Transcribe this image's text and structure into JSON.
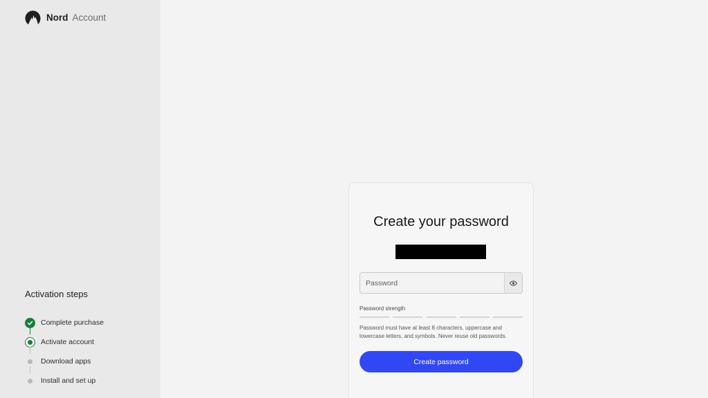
{
  "brand": {
    "name": "Nord",
    "product": "Account",
    "icon": "nord-mountain-logo-icon"
  },
  "activation": {
    "title": "Activation steps",
    "steps": [
      {
        "label": "Complete purchase",
        "status": "done"
      },
      {
        "label": "Activate account",
        "status": "current"
      },
      {
        "label": "Download apps",
        "status": "pending"
      },
      {
        "label": "Install and set up",
        "status": "pending"
      }
    ]
  },
  "card": {
    "title": "Create your password",
    "password_placeholder": "Password",
    "strength_label": "Password strength",
    "strength_segments_filled": 0,
    "strength_segments_total": 5,
    "hint": "Password must have at least 8 characters, uppercase and lowercase letters, and symbols. Never reuse old passwords.",
    "button_label": "Create password"
  },
  "colors": {
    "accent": "#3147f5",
    "success": "#1a7d3c",
    "sidebar_bg": "#e9e9e9",
    "page_bg": "#f2f3f2"
  }
}
